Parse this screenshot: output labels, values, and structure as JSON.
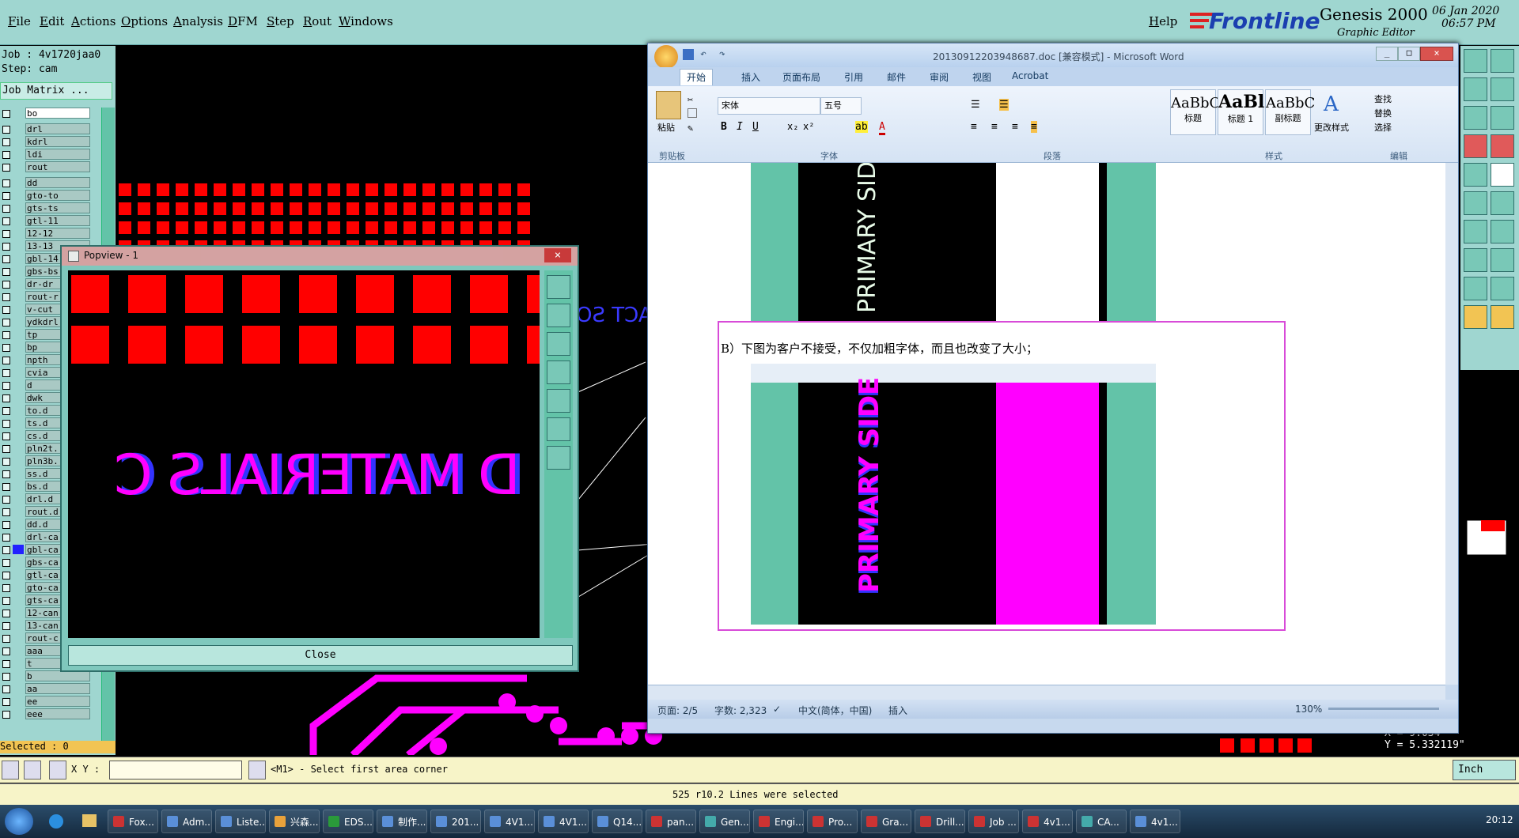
{
  "genesis": {
    "menu": [
      "File",
      "Edit",
      "Actions",
      "Options",
      "Analysis",
      "DFM",
      "Step",
      "Rout",
      "Windows"
    ],
    "help": "Help",
    "brand": "Frontline",
    "product": "Genesis 2000",
    "subtitle": "Graphic Editor",
    "date": "06 Jan 2020",
    "time": "06:57 PM",
    "job_label": "Job : 4v1720jaa0",
    "step_label": "Step: cam",
    "job_matrix": "Job Matrix ...",
    "layers": [
      "bo",
      "drl",
      "kdrl",
      "ldi",
      "rout",
      "dd",
      "gto-to",
      "gts-ts",
      "gtl-11",
      "12-12",
      "13-13",
      "gbl-14",
      "gbs-bs",
      "dr-dr",
      "rout-r",
      "v-cut",
      "ydkdrl",
      "tp",
      "bp",
      "npth",
      "cvia",
      "d",
      "dwk",
      "to.d",
      "ts.d",
      "cs.d",
      "pln2t.",
      "pln3b.",
      "ss.d",
      "bs.d",
      "drl.d",
      "rout.d",
      "dd.d",
      "drl-ca",
      "gbl-ca",
      "gbs-ca",
      "gtl-ca",
      "gto-ca",
      "gts-ca",
      "12-can",
      "13-can",
      "rout-c",
      "aaa",
      "t",
      "b",
      "aa",
      "ee",
      "eee"
    ],
    "selected": "Selected : 0",
    "xy_label": "X Y :",
    "prompt": "<M1> - Select first area corner",
    "units": "Inch",
    "status_msg": "525 r10.2 Lines were selected",
    "coord_x": "X = 9.034\"",
    "coord_y": "Y = 5.332119\"",
    "pcb_text": "ACT SO"
  },
  "popview": {
    "title": "Popview - 1",
    "close": "Close",
    "text": "D MATERIALS C"
  },
  "word": {
    "title": "20130912203948687.doc [兼容模式] - Microsoft Word",
    "tabs": [
      "开始",
      "插入",
      "页面布局",
      "引用",
      "邮件",
      "审阅",
      "视图",
      "Acrobat"
    ],
    "paste": "粘贴",
    "font_name": "宋体",
    "font_size": "五号",
    "styles": [
      {
        "sample": "AaBbC",
        "name": "标题"
      },
      {
        "sample": "AaBl",
        "name": "标题 1"
      },
      {
        "sample": "AaBbC",
        "name": "副标题"
      }
    ],
    "change_styles": "更改样式",
    "edit_items": [
      "查找",
      "替换",
      "选择"
    ],
    "groups": [
      "剪贴板",
      "字体",
      "段落",
      "样式",
      "编辑"
    ],
    "doc_text": "B）下图为客户不接受，不仅加粗字体，而且也改变了大小；",
    "img_text1": "PRIMARY SIDE",
    "img_text2": "PRIMARY SIDE",
    "status": {
      "page": "页面: 2/5",
      "words": "字数: 2,323",
      "lang": "中文(简体，中国)",
      "mode": "插入",
      "zoom": "130%"
    }
  },
  "taskbar": {
    "items": [
      "Fox...",
      "Adm...",
      "Liste...",
      "兴森...",
      "EDS...",
      "制作...",
      "201...",
      "4V1...",
      "4V1...",
      "Q14...",
      "pan...",
      "Gen...",
      "Engi...",
      "Pro...",
      "Gra...",
      "Drill...",
      "Job ...",
      "4v1...",
      "CA...",
      "4v1..."
    ],
    "clock": "20:12"
  },
  "colors": {
    "genesis_panel": "#9fd6d0",
    "pad_red": "#ff0000",
    "trace_magenta": "#ff00ff",
    "word_blue": "#c7d9ee"
  }
}
